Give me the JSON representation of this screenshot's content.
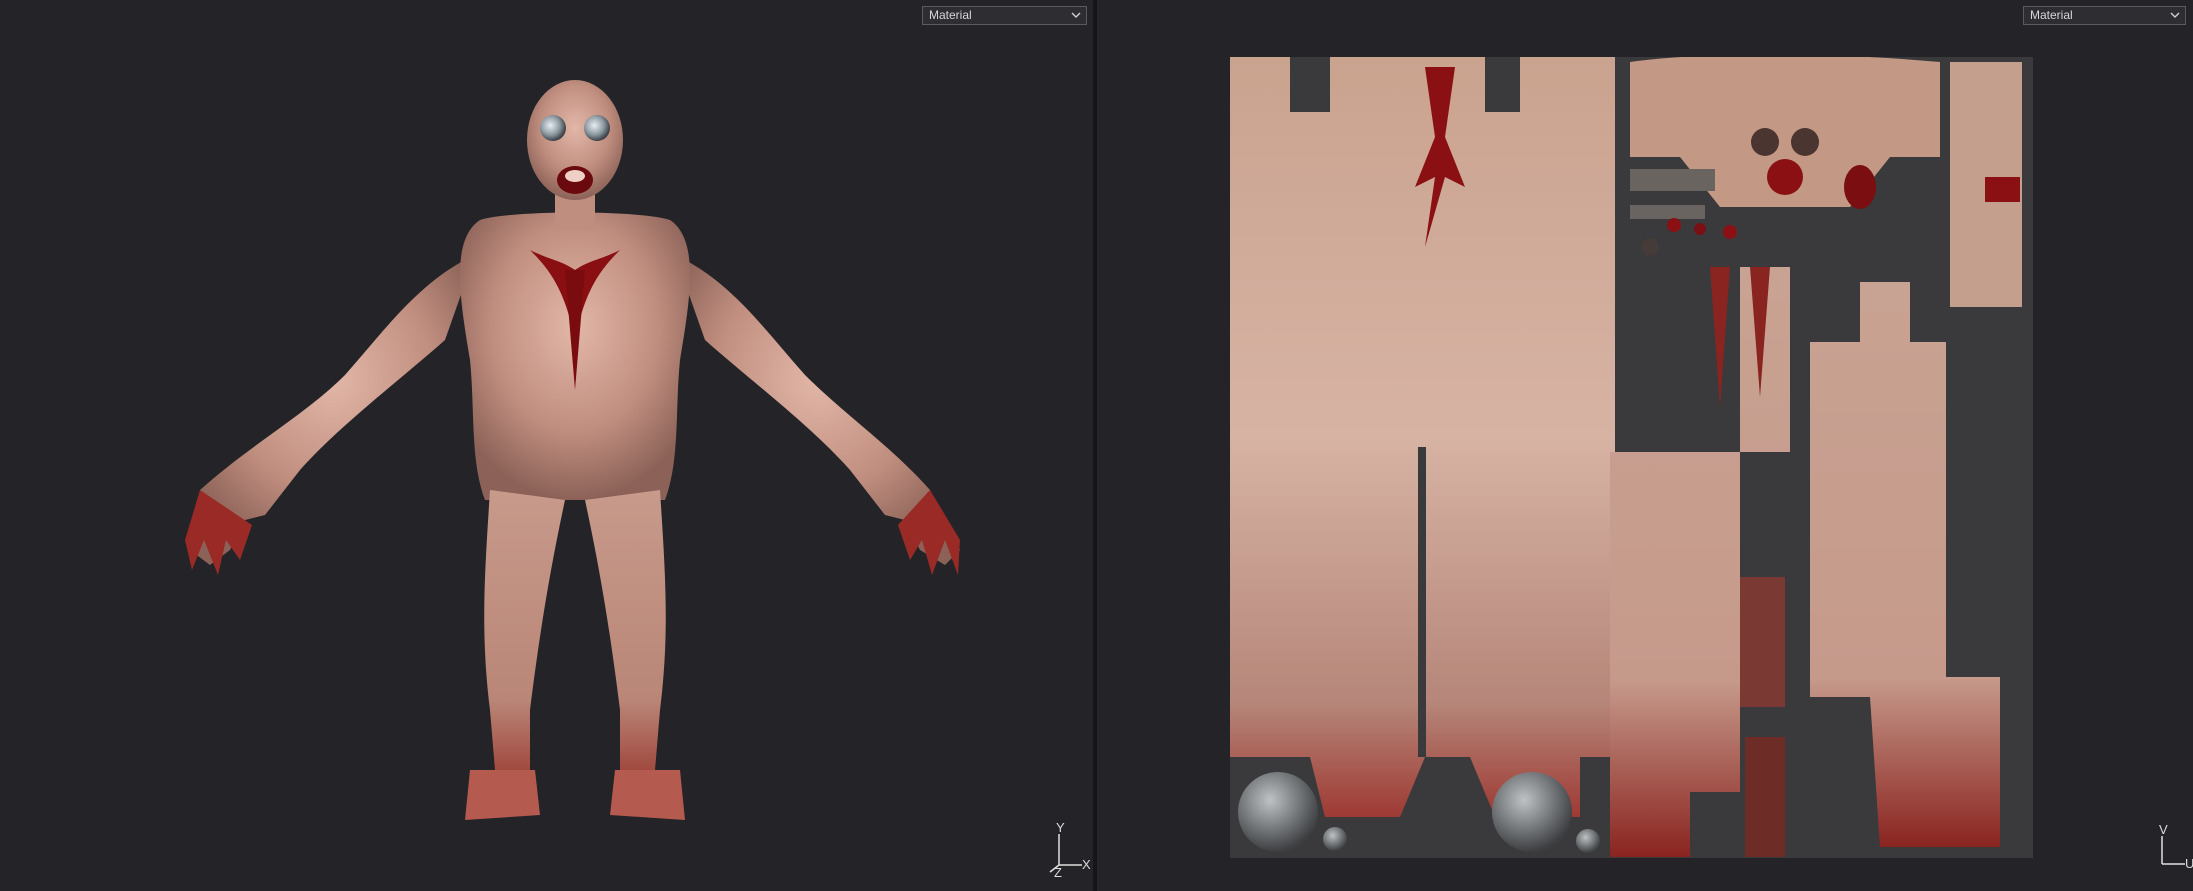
{
  "viewport_3d": {
    "shading_mode": {
      "value": "Material",
      "options": [
        "Material"
      ]
    },
    "axis_gizmo": {
      "y_label": "Y",
      "x_label": "X",
      "z_label": "Z"
    }
  },
  "viewport_2d": {
    "shading_mode": {
      "value": "Material",
      "options": [
        "Material"
      ]
    },
    "axis_gizmo": {
      "v_label": "V",
      "u_label": "U"
    }
  },
  "colors": {
    "background": "#242428",
    "skin": "#c99a8a",
    "blood": "#8a0f12",
    "uv_bg": "#3a3a3c",
    "divider": "#161618"
  },
  "icons": [
    "chevron-down-icon",
    "axis-gizmo-icon"
  ]
}
